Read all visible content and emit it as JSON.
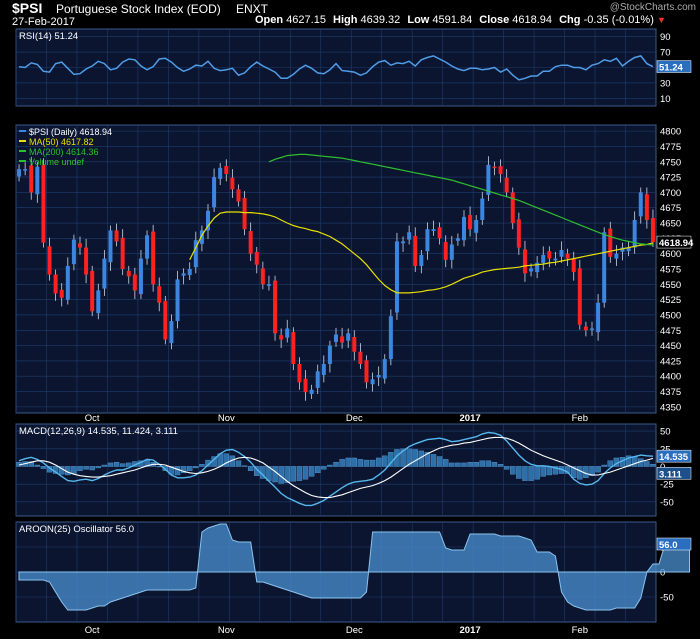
{
  "header": {
    "symbol": "$PSI",
    "name": "Portuguese Stock Index (EOD)",
    "exchange": "ENXT",
    "date": "27-Feb-2017",
    "watermark": "@StockCharts.com",
    "open_label": "Open",
    "open": "4627.15",
    "high_label": "High",
    "high": "4639.32",
    "low_label": "Low",
    "low": "4591.84",
    "close_label": "Close",
    "close": "4618.94",
    "chg_label": "Chg",
    "chg": "-0.35 (-0.01%)"
  },
  "colors": {
    "background": "#000000",
    "panel": "#0b1530",
    "grid": "#1f3d6e",
    "up": "#3d86e0",
    "down": "#ff2020",
    "ma50": "#e8e000",
    "ma200": "#2ebf2e",
    "rsi": "#4f9de8",
    "macd": "#55b8ee",
    "signal": "#ffffff",
    "histogram": "#2d6fa8",
    "aroon": "#4a90d0"
  },
  "chart_data": [
    {
      "type": "line",
      "title": "RSI(14) 51.24",
      "last_value_label": "51.24",
      "y_ticks": [
        "90",
        "70",
        "50",
        "30",
        "10"
      ],
      "ylim": [
        0,
        100
      ],
      "series": [
        {
          "name": "RSI(14)",
          "values": [
            51,
            50,
            56,
            54,
            45,
            44,
            55,
            57,
            49,
            41,
            42,
            48,
            52,
            58,
            55,
            47,
            49,
            57,
            61,
            60,
            52,
            47,
            51,
            61,
            62,
            57,
            50,
            45,
            48,
            53,
            52,
            58,
            49,
            46,
            47,
            49,
            40,
            43,
            51,
            57,
            52,
            48,
            44,
            36,
            36,
            41,
            48,
            53,
            49,
            43,
            42,
            47,
            55,
            46,
            45,
            44,
            40,
            43,
            51,
            57,
            59,
            53,
            56,
            55,
            58,
            52,
            60,
            63,
            65,
            61,
            57,
            52,
            48,
            46,
            49,
            49,
            47,
            48,
            50,
            44,
            48,
            40,
            34,
            36,
            39,
            39,
            45,
            45,
            51,
            53,
            53,
            50,
            50,
            47,
            53,
            55,
            60,
            58,
            62,
            52,
            58,
            63,
            65,
            55,
            51
          ]
        }
      ]
    },
    {
      "type": "candlestick",
      "legend": [
        {
          "label": "$PSI (Daily) 4618.94",
          "color_key": "up"
        },
        {
          "label": "MA(50) 4617.82",
          "color_key": "ma50"
        },
        {
          "label": "MA(200) 4614.36",
          "color_key": "ma200"
        },
        {
          "label": "Volume undef",
          "color_key": "ma200"
        }
      ],
      "last_value_label": "4618.94",
      "y_ticks": [
        "4800",
        "4775",
        "4750",
        "4725",
        "4700",
        "4675",
        "4650",
        "4625",
        "4600",
        "4575",
        "4550",
        "4525",
        "4500",
        "4475",
        "4450",
        "4425",
        "4400",
        "4375",
        "4350"
      ],
      "ylim": [
        4340,
        4810
      ],
      "x_labels": [
        {
          "label": "Oct",
          "index": 12
        },
        {
          "label": "Nov",
          "index": 34
        },
        {
          "label": "Dec",
          "index": 55
        },
        {
          "label": "2017",
          "index": 74
        },
        {
          "label": "Feb",
          "index": 92
        }
      ],
      "series": [
        {
          "name": "$PSI (Daily)",
          "close": [
            4738,
            4738,
            4700,
            4742,
            4618,
            4566,
            4535,
            4528,
            4580,
            4623,
            4610,
            4566,
            4506,
            4540,
            4592,
            4638,
            4620,
            4575,
            4563,
            4540,
            4592,
            4630,
            4550,
            4520,
            4460,
            4490,
            4558,
            4568,
            4575,
            4622,
            4638,
            4670,
            4725,
            4740,
            4730,
            4705,
            4685,
            4640,
            4600,
            4582,
            4550,
            4550,
            4470,
            4460,
            4478,
            4420,
            4390,
            4374,
            4378,
            4408,
            4420,
            4450,
            4468,
            4455,
            4470,
            4440,
            4420,
            4390,
            4395,
            4402,
            4428,
            4498,
            4620,
            4620,
            4635,
            4580,
            4598,
            4640,
            4640,
            4625,
            4590,
            4615,
            4625,
            4660,
            4640,
            4655,
            4690,
            4745,
            4740,
            4730,
            4700,
            4650,
            4610,
            4568,
            4576,
            4585,
            4598,
            4592,
            4592,
            4606,
            4592,
            4570,
            4484,
            4475,
            4478,
            4520,
            4635,
            4595,
            4600,
            4610,
            4610,
            4655,
            4700,
            4655,
            4618.94
          ]
        },
        {
          "name": "MA(50)",
          "values": [
            4590,
            4610,
            4630,
            4645,
            4658,
            4666,
            4668,
            4668,
            4668,
            4667,
            4667,
            4666,
            4665,
            4663,
            4660,
            4655,
            4650,
            4646,
            4643,
            4641,
            4638,
            4636,
            4632,
            4628,
            4622,
            4616,
            4608,
            4600,
            4592,
            4582,
            4570,
            4558,
            4548,
            4541,
            4536,
            4536,
            4536,
            4537,
            4538,
            4540,
            4541,
            4543,
            4546,
            4550,
            4555,
            4560,
            4563,
            4566,
            4570,
            4572,
            4574,
            4575,
            4576,
            4577,
            4578,
            4580,
            4581,
            4582,
            4583,
            4585,
            4586,
            4588,
            4590,
            4592,
            4594,
            4596,
            4598,
            4600,
            4602,
            4604,
            4606,
            4608,
            4610,
            4612,
            4614,
            4615,
            4617.82
          ]
        },
        {
          "name": "MA(200)",
          "values": [
            4750,
            4754,
            4757,
            4760,
            4761,
            4762,
            4762,
            4761,
            4760,
            4759,
            4758,
            4757,
            4756,
            4754,
            4752,
            4750,
            4748,
            4746,
            4744,
            4742,
            4740,
            4738,
            4736,
            4734,
            4732,
            4730,
            4728,
            4726,
            4724,
            4722,
            4720,
            4717,
            4714,
            4711,
            4708,
            4705,
            4702,
            4699,
            4696,
            4693,
            4690,
            4687,
            4683,
            4679,
            4675,
            4671,
            4667,
            4663,
            4659,
            4655,
            4651,
            4647,
            4643,
            4639,
            4635,
            4631,
            4628,
            4625,
            4622,
            4620,
            4618,
            4616,
            4615,
            4614.36
          ]
        }
      ]
    },
    {
      "type": "line",
      "title": "MACD(12,26,9) 14.535, 11.424, 3.111",
      "value_labels": [
        "14.535",
        "3.111"
      ],
      "y_ticks": [
        "50",
        "25",
        "0",
        "-25",
        "-50"
      ],
      "ylim": [
        -70,
        60
      ],
      "series": [
        {
          "name": "MACD",
          "values": [
            8,
            11,
            13,
            10,
            5,
            -2,
            -8,
            -14,
            -20,
            -21,
            -19,
            -18,
            -20,
            -17,
            -12,
            -8,
            -5,
            -5,
            -2,
            2,
            6,
            10,
            9,
            3,
            -4,
            -12,
            -16,
            -16,
            -15,
            -12,
            -6,
            2,
            10,
            18,
            23,
            24,
            20,
            14,
            6,
            -4,
            -12,
            -21,
            -29,
            -38,
            -44,
            -48,
            -52,
            -55,
            -55,
            -52,
            -48,
            -42,
            -36,
            -30,
            -25,
            -22,
            -21,
            -20,
            -18,
            -12,
            -5,
            5,
            15,
            22,
            28,
            32,
            35,
            38,
            39,
            40,
            38,
            35,
            36,
            38,
            40,
            42,
            46,
            48,
            47,
            44,
            36,
            26,
            16,
            8,
            3,
            1,
            1,
            0,
            -2,
            -4,
            -8,
            -18,
            -24,
            -26,
            -25,
            -20,
            -10,
            -2,
            4,
            8,
            12,
            14,
            16,
            15,
            14.535
          ]
        },
        {
          "name": "Signal",
          "values": [
            2,
            4,
            6,
            8,
            8,
            6,
            2,
            -3,
            -8,
            -11,
            -13,
            -14,
            -15,
            -15,
            -14,
            -13,
            -11,
            -9,
            -7,
            -5,
            -2,
            1,
            3,
            3,
            2,
            -1,
            -4,
            -7,
            -9,
            -10,
            -9,
            -7,
            -4,
            0,
            5,
            9,
            12,
            13,
            12,
            9,
            5,
            -1,
            -7,
            -14,
            -21,
            -27,
            -32,
            -37,
            -41,
            -43,
            -44,
            -44,
            -42,
            -40,
            -37,
            -34,
            -31,
            -29,
            -27,
            -24,
            -20,
            -15,
            -9,
            -3,
            3,
            8,
            13,
            18,
            22,
            26,
            28,
            30,
            31,
            33,
            34,
            36,
            38,
            40,
            41,
            41,
            40,
            37,
            33,
            28,
            23,
            19,
            15,
            12,
            9,
            6,
            2,
            -2,
            -6,
            -10,
            -12,
            -12,
            -10,
            -8,
            -5,
            -2,
            1,
            4,
            7,
            9,
            11.424
          ]
        },
        {
          "name": "Histogram",
          "values": [
            6,
            7,
            7,
            2,
            -3,
            -8,
            -10,
            -11,
            -12,
            -10,
            -6,
            -4,
            -5,
            -2,
            2,
            5,
            6,
            4,
            5,
            7,
            8,
            9,
            6,
            0,
            -6,
            -11,
            -12,
            -9,
            -6,
            -2,
            3,
            9,
            14,
            18,
            18,
            15,
            8,
            1,
            -6,
            -13,
            -17,
            -20,
            -22,
            -24,
            -23,
            -21,
            -20,
            -18,
            -14,
            -9,
            -4,
            2,
            6,
            10,
            12,
            12,
            10,
            9,
            9,
            12,
            15,
            20,
            24,
            25,
            25,
            24,
            22,
            20,
            17,
            14,
            10,
            5,
            5,
            5,
            6,
            6,
            8,
            8,
            6,
            3,
            -4,
            -11,
            -17,
            -20,
            -20,
            -18,
            -14,
            -12,
            -11,
            -10,
            -10,
            -16,
            -18,
            -16,
            -13,
            -8,
            2,
            8,
            12,
            13,
            15,
            14,
            11,
            7,
            3.111
          ]
        }
      ]
    },
    {
      "type": "area",
      "title": "AROON(25) Oscillator 56.0",
      "last_value_label": "56.0",
      "y_ticks": [
        "50",
        "0",
        "-50"
      ],
      "ylim": [
        -100,
        100
      ],
      "x_labels": [
        {
          "label": "Oct",
          "index": 12
        },
        {
          "label": "Nov",
          "index": 34
        },
        {
          "label": "Dec",
          "index": 55
        },
        {
          "label": "2017",
          "index": 74
        },
        {
          "label": "Feb",
          "index": 92
        }
      ],
      "series": [
        {
          "name": "AROON(25) Oscillator",
          "values": [
            -16,
            -16,
            -16,
            -16,
            -16,
            -20,
            -40,
            -60,
            -76,
            -76,
            -76,
            -76,
            -72,
            -68,
            -68,
            -60,
            -56,
            -52,
            -48,
            -44,
            -40,
            -36,
            -36,
            -36,
            -36,
            -36,
            -36,
            -36,
            -36,
            -32,
            80,
            88,
            92,
            96,
            96,
            64,
            60,
            60,
            60,
            -20,
            -20,
            -24,
            -28,
            -32,
            -36,
            -40,
            -44,
            -48,
            -52,
            -52,
            -52,
            -52,
            -52,
            -52,
            -52,
            -52,
            -52,
            -40,
            80,
            80,
            80,
            80,
            80,
            80,
            80,
            80,
            80,
            80,
            80,
            80,
            48,
            44,
            44,
            44,
            76,
            76,
            76,
            76,
            76,
            72,
            72,
            72,
            72,
            68,
            64,
            40,
            40,
            40,
            32,
            -40,
            -60,
            -68,
            -72,
            -76,
            -76,
            -76,
            -76,
            -76,
            -72,
            -72,
            -72,
            -72,
            -52,
            0,
            16,
            16,
            56,
            56,
            56,
            56,
            56
          ]
        }
      ]
    }
  ]
}
